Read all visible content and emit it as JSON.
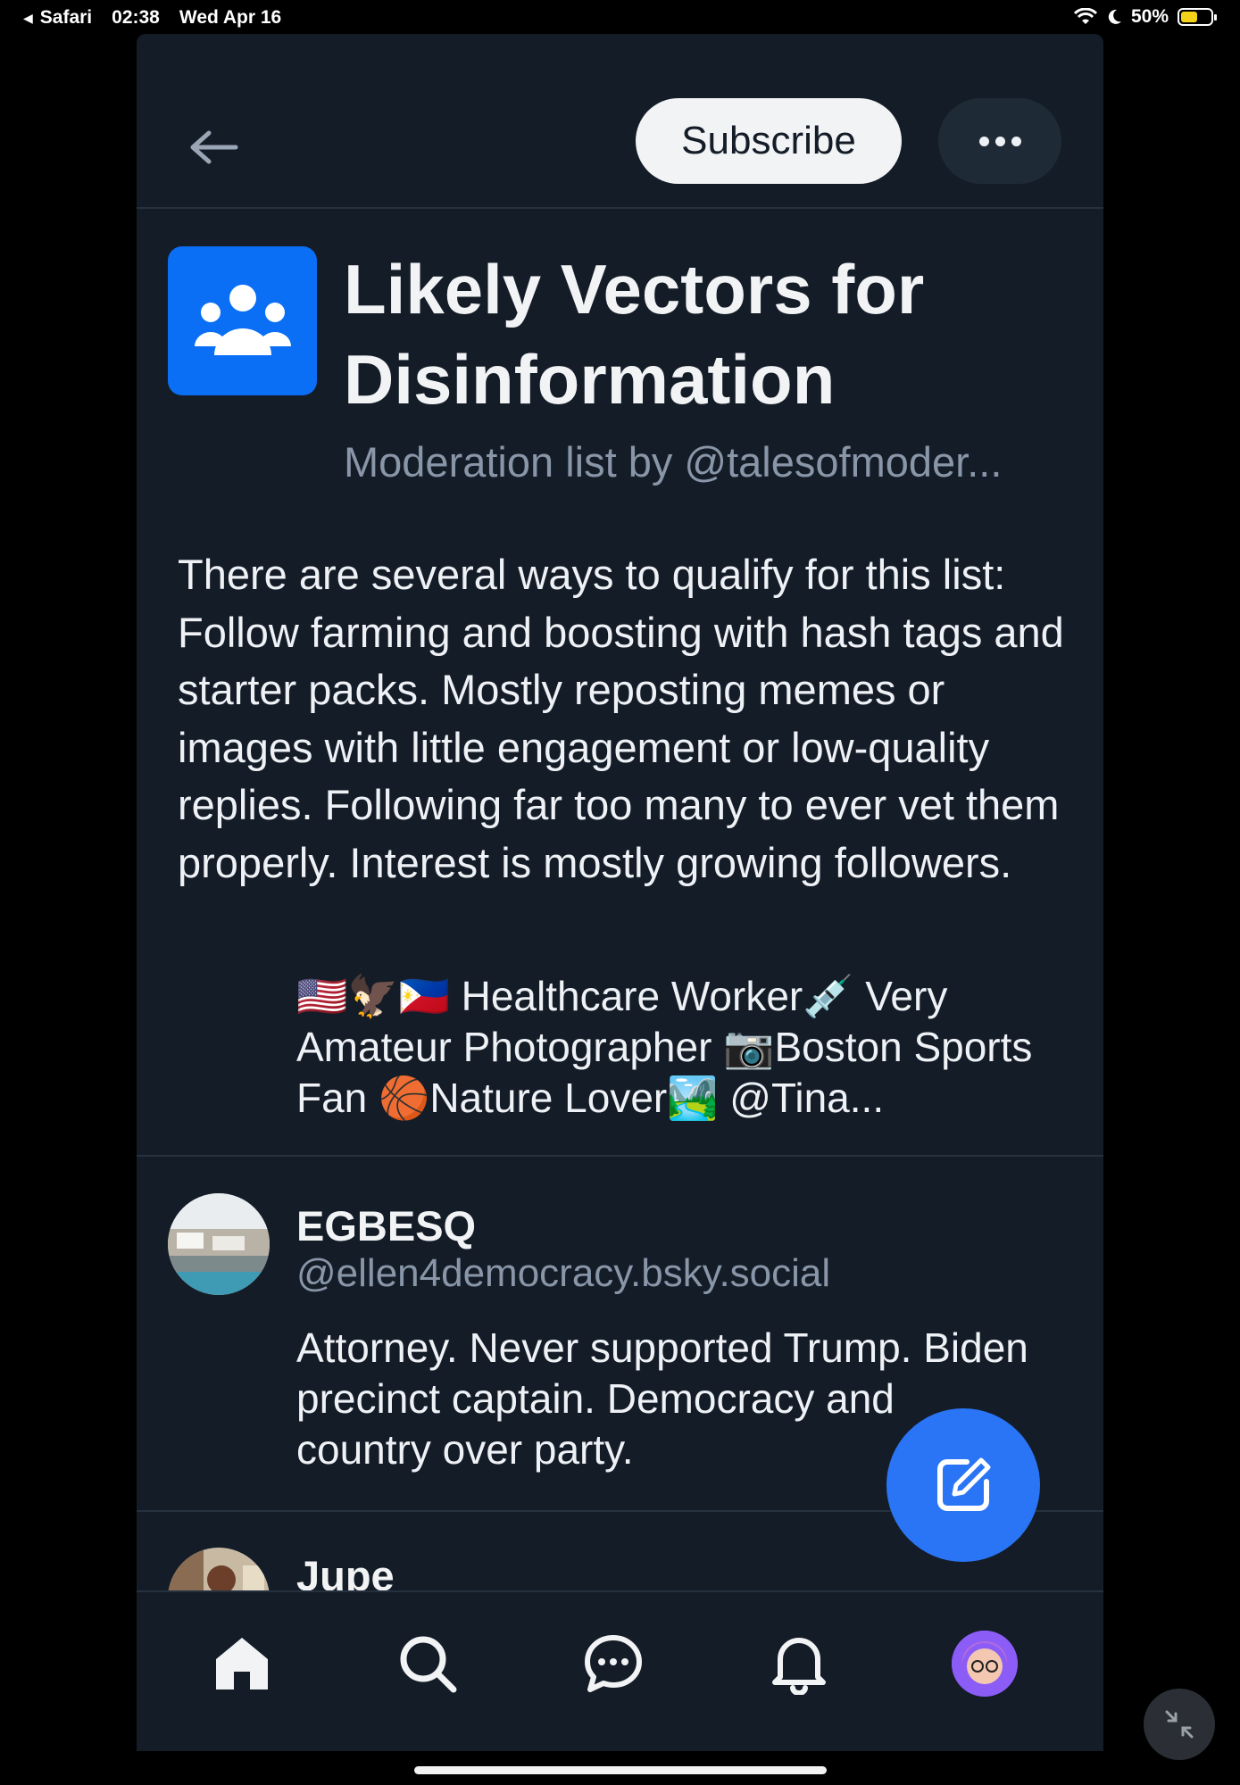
{
  "status_bar": {
    "app": "Safari",
    "time": "02:38",
    "date": "Wed Apr 16",
    "battery": "50%",
    "battery_level": 0.5
  },
  "header": {
    "subscribe_label": "Subscribe"
  },
  "list": {
    "title": "Likely Vectors for Disinformation",
    "subtitle": "Moderation list by @talesofmoder...",
    "description": "There are several ways to qualify for this list: Follow farming and boosting with hash tags and starter packs. Mostly reposting memes or images with little engagement or low-quality replies. Following far too many to ever vet them properly. Interest is mostly growing followers.",
    "bio_snippet": "🇺🇸🦅🇵🇭 Healthcare Worker💉 Very Amateur Photographer 📷Boston Sports Fan 🏀Nature Lover🏞️ @Tina..."
  },
  "members": [
    {
      "name": "EGBESQ",
      "handle": "@ellen4democracy.bsky.social",
      "bio": "Attorney.  Never supported Trump. Biden precinct captain. Democracy and country over party."
    },
    {
      "name": "Jupe",
      "handle": "",
      "bio": ""
    }
  ],
  "nav": {
    "items": [
      "home-icon",
      "search-icon",
      "chat-icon",
      "bell-icon",
      "profile-avatar"
    ]
  },
  "colors": {
    "background": "#141c27",
    "accent": "#0a6ff5",
    "fab": "#2a75f5",
    "muted": "#8896a8"
  }
}
